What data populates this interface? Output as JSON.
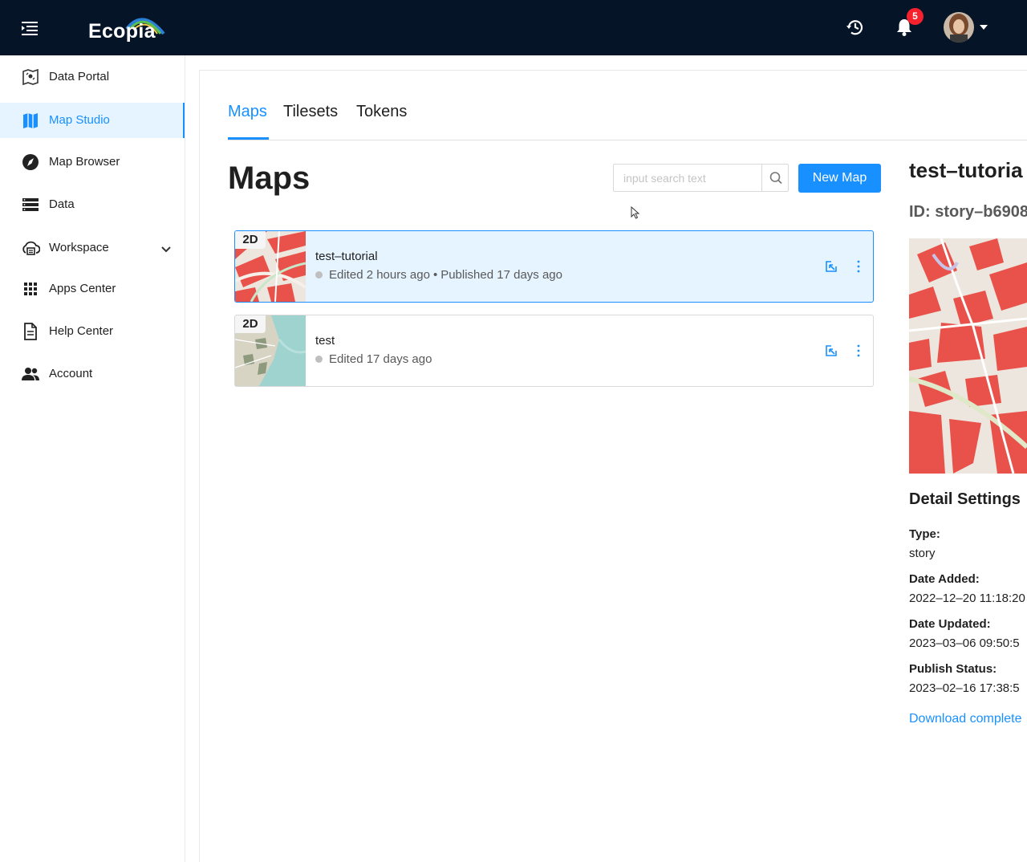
{
  "header": {
    "logo_text": "Ecopia",
    "notification_count": "5",
    "icons": {
      "menu": "menu-fold-icon",
      "history": "history-icon",
      "notifications": "bell-icon",
      "avatar": "user-avatar",
      "caret": "caret-down-icon"
    }
  },
  "sidebar": {
    "items": [
      {
        "label": "Data Portal",
        "icon": "data-portal-icon"
      },
      {
        "label": "Map Studio",
        "icon": "map-icon",
        "active": true
      },
      {
        "label": "Map Browser",
        "icon": "compass-icon"
      },
      {
        "label": "Data",
        "icon": "database-icon"
      },
      {
        "label": "Workspace",
        "icon": "cloud-workspace-icon",
        "expandable": true
      },
      {
        "label": "Apps Center",
        "icon": "apps-grid-icon"
      },
      {
        "label": "Help Center",
        "icon": "document-icon"
      },
      {
        "label": "Account",
        "icon": "team-icon"
      }
    ]
  },
  "tabs": [
    {
      "label": "Maps",
      "active": true
    },
    {
      "label": "Tilesets"
    },
    {
      "label": "Tokens"
    }
  ],
  "main": {
    "title": "Maps",
    "search_placeholder": "input search text",
    "new_map_label": "New Map"
  },
  "maps": [
    {
      "dimension": "2D",
      "name": "test–tutorial",
      "edited": "Edited 2 hours ago",
      "separator": "•",
      "published": "Published 17 days ago",
      "selected": true
    },
    {
      "dimension": "2D",
      "name": "test",
      "edited": "Edited 17 days ago",
      "selected": false
    }
  ],
  "detail": {
    "title": "test–tutoria",
    "id": "ID: story–b6908",
    "heading": "Detail Settings",
    "fields": [
      {
        "label": "Type:",
        "value": "story"
      },
      {
        "label": "Date Added:",
        "value": "2022–12–20 11:18:20"
      },
      {
        "label": "Date Updated:",
        "value": "2023–03–06 09:50:5"
      },
      {
        "label": "Publish Status:",
        "value": "2023–02–16 17:38:5"
      }
    ],
    "download_link": "Download complete"
  },
  "colors": {
    "topbar": "#061428",
    "accent": "#1890ff",
    "selected_bg": "#e6f4ff",
    "badge": "#f5222d",
    "building_red": "#e8524a"
  }
}
